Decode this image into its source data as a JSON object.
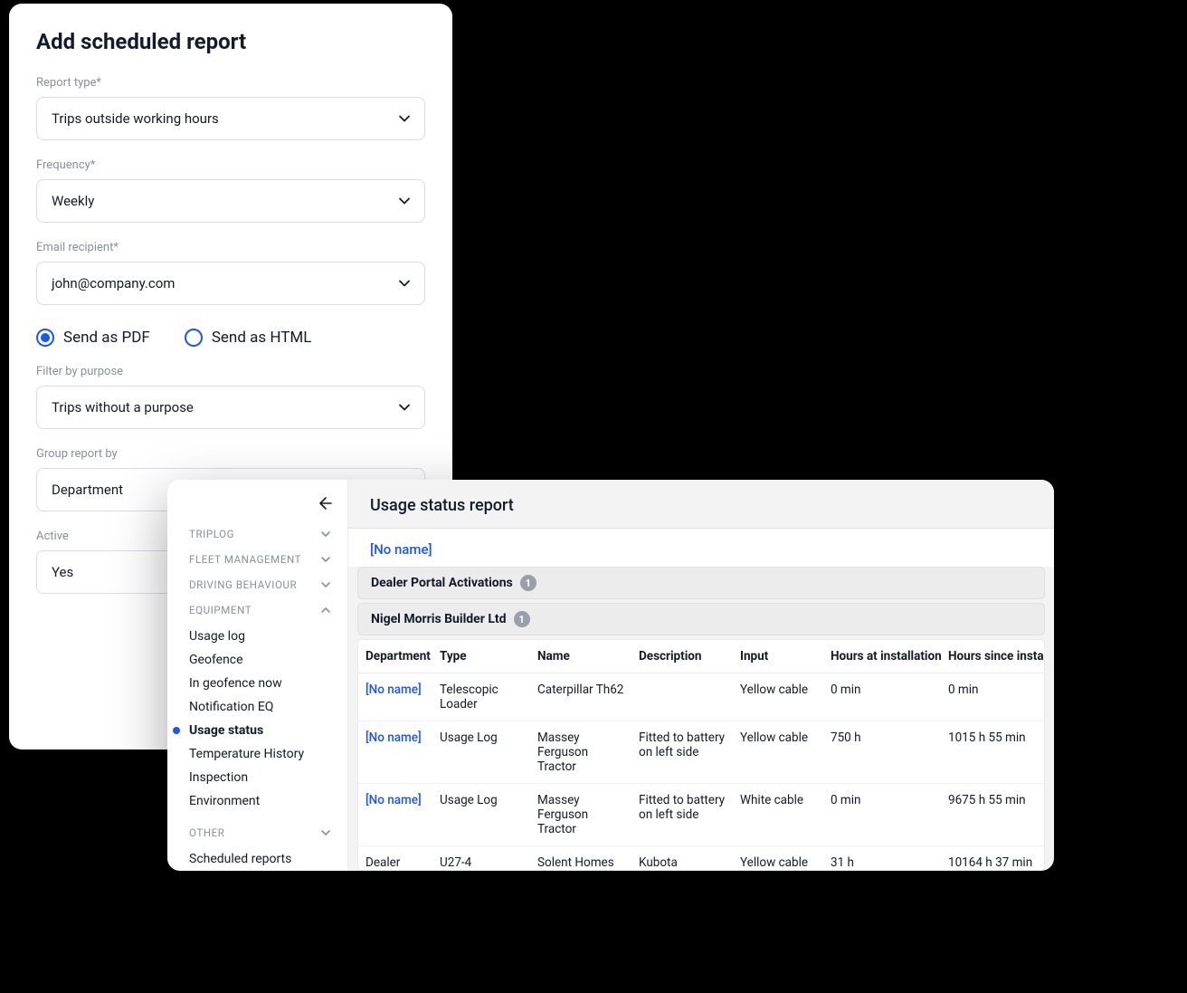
{
  "leftPanel": {
    "title": "Add scheduled report",
    "labels": {
      "reportType": "Report type*",
      "frequency": "Frequency*",
      "emailRecipient": "Email recipient*",
      "filterByPurpose": "Filter by purpose",
      "groupReportBy": "Group report by",
      "active": "Active"
    },
    "values": {
      "reportType": "Trips outside working hours",
      "frequency": "Weekly",
      "emailRecipient": "john@company.com",
      "filterByPurpose": "Trips without a purpose",
      "groupReportBy": "Department",
      "active": "Yes"
    },
    "radios": {
      "pdf": "Send as PDF",
      "html": "Send as HTML"
    }
  },
  "sidebar": {
    "sections": {
      "triplog": "TRIPLOG",
      "fleet": "FLEET MANAGEMENT",
      "driving": "DRIVING BEHAVIOUR",
      "equipment": "EQUIPMENT",
      "other": "OTHER"
    },
    "equipmentItems": [
      "Usage log",
      "Geofence",
      "In geofence now",
      "Notification EQ",
      "Usage status",
      "Temperature History",
      "Inspection",
      "Environment"
    ],
    "otherItems": [
      "Scheduled reports"
    ]
  },
  "report": {
    "title": "Usage status report",
    "topLink": "[No name]",
    "groups": [
      {
        "name": "Dealer Portal Activations",
        "count": "1"
      },
      {
        "name": "Nigel Morris Builder Ltd",
        "count": "1"
      }
    ],
    "columns": {
      "department": "Department",
      "type": "Type",
      "name": "Name",
      "description": "Description",
      "input": "Input",
      "hoursAtInstall": "Hours at installation",
      "hoursSinceInstall": "Hours since install"
    },
    "rows": [
      {
        "department": "[No name]",
        "type": "Telescopic Loader",
        "name": "Caterpillar Th62",
        "description": "",
        "input": "Yellow cable",
        "hoursAtInstall": "0 min",
        "hoursSinceInstall": "0 min"
      },
      {
        "department": "[No name]",
        "type": "Usage Log",
        "name": "Massey Ferguson Tractor",
        "description": "Fitted to battery on left side",
        "input": "Yellow cable",
        "hoursAtInstall": "750 h",
        "hoursSinceInstall": "1015 h 55 min"
      },
      {
        "department": "[No name]",
        "type": "Usage Log",
        "name": "Massey Ferguson Tractor",
        "description": "Fitted to battery on left side",
        "input": "White cable",
        "hoursAtInstall": "0 min",
        "hoursSinceInstall": "9675 h 55 min"
      },
      {
        "department": "Dealer Portal",
        "type": "U27-4",
        "name": "Solent Homes",
        "description": "Kubota",
        "input": "Yellow cable",
        "hoursAtInstall": "31 h",
        "hoursSinceInstall": "10164 h 37 min"
      }
    ]
  }
}
